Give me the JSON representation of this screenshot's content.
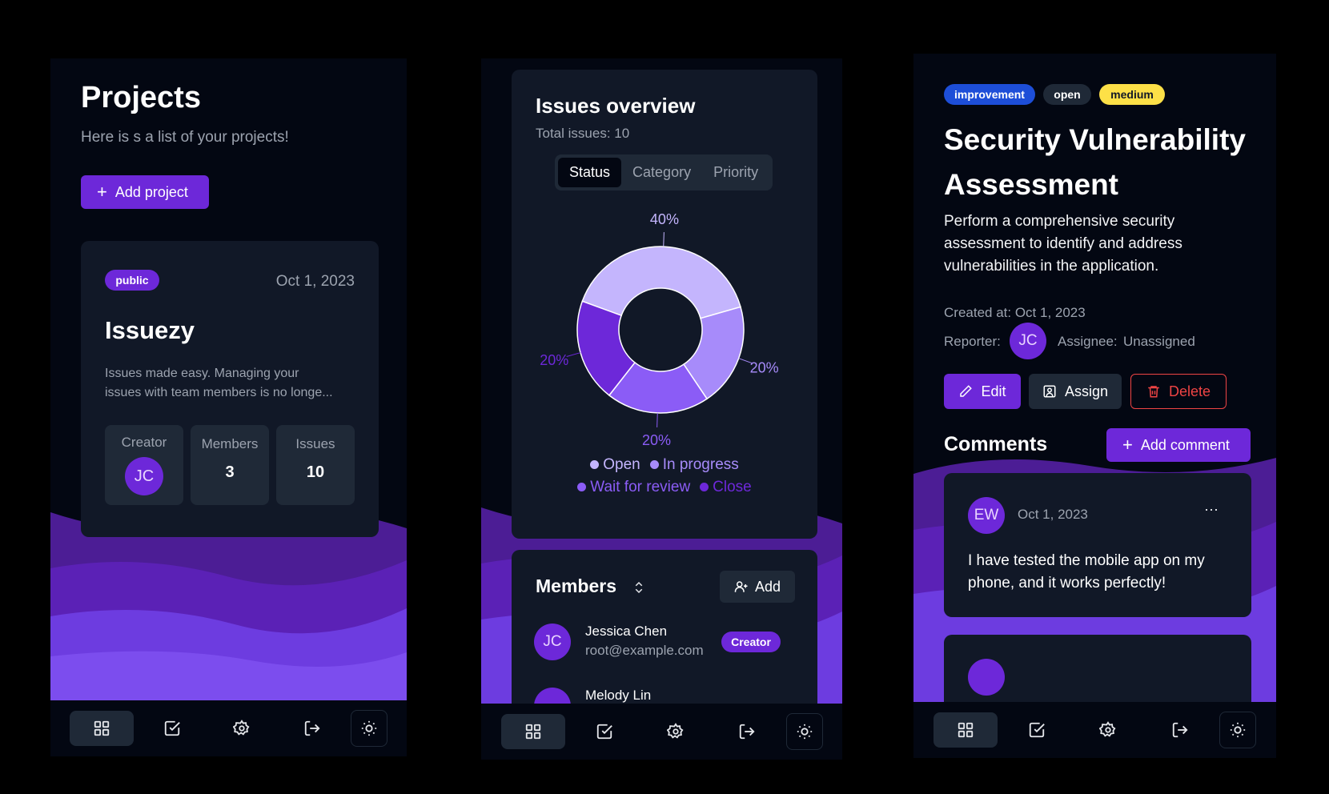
{
  "projects_screen": {
    "title": "Projects",
    "subtitle": "Here is s a list of your projects!",
    "add_button": "Add project",
    "project": {
      "visibility": "public",
      "date": "Oct 1, 2023",
      "name": "Issuezy",
      "description_line1": "Issues made easy. Managing your",
      "description_line2": "issues with team members is no longe...",
      "creator_label": "Creator",
      "creator_initials": "JC",
      "members_label": "Members",
      "members_count": "3",
      "issues_label": "Issues",
      "issues_count": "10"
    }
  },
  "overview_screen": {
    "title": "Issues overview",
    "total": "Total issues: 10",
    "tabs": [
      "Status",
      "Category",
      "Priority"
    ],
    "members_title": "Members",
    "add_member": "Add",
    "member": {
      "initials": "JC",
      "name": "Jessica Chen",
      "email": "root@example.com",
      "role": "Creator"
    },
    "partial_member_name": "Melody Lin"
  },
  "chart_data": {
    "type": "pie",
    "categories": [
      "Open",
      "In progress",
      "Wait for review",
      "Close"
    ],
    "values": [
      40,
      20,
      20,
      20
    ],
    "value_labels": [
      "40%",
      "20%",
      "20%",
      "20%"
    ],
    "colors": [
      "#c4b5fd",
      "#a78bfa",
      "#8b5cf6",
      "#6d28d9"
    ],
    "legend_placement": "bottom"
  },
  "issue_screen": {
    "tags": [
      "improvement",
      "open",
      "medium"
    ],
    "title_line1": "Security Vulnerability",
    "title_line2": "Assessment",
    "desc_line1": "Perform a comprehensive security",
    "desc_line2": "assessment to identify and address",
    "desc_line3": "vulnerabilities in the application.",
    "created": "Created at: Oct 1, 2023",
    "reporter_label": "Reporter:",
    "reporter_initials": "JC",
    "assignee_label": "Assignee:",
    "assignee_value": "Unassigned",
    "edit": "Edit",
    "assign": "Assign",
    "delete": "Delete",
    "comments_title": "Comments",
    "add_comment": "Add comment",
    "comment": {
      "initials": "EW",
      "date": "Oct 1, 2023",
      "line1": "I have tested the mobile app on my",
      "line2": "phone, and it works perfectly!"
    }
  },
  "colors": {
    "accent": "#6d28d9",
    "background": "#030712",
    "card": "#111827",
    "tag_improvement": "#1d4ed8",
    "tag_medium": "#fde047",
    "delete": "#ef4444"
  }
}
